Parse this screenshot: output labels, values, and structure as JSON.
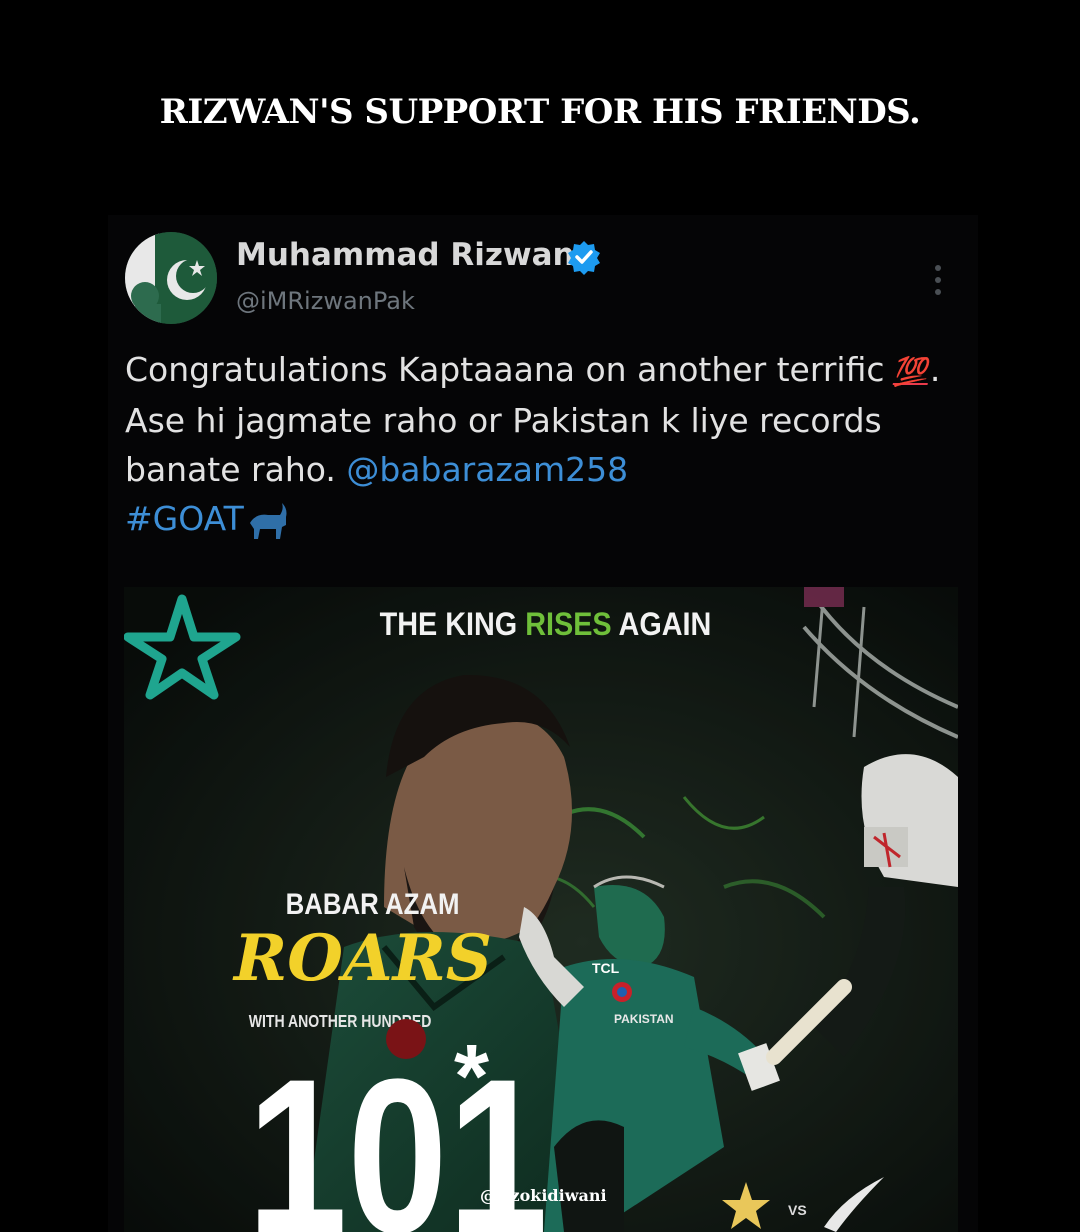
{
  "headline": "RIZWAN'S SUPPORT FOR HIS FRIENDS.",
  "tweet": {
    "author_name": "Muhammad Rizwan",
    "handle": "@iMRizwanPak",
    "verified": true,
    "text_part1": "Congratulations Kaptaaana on another terrific",
    "emoji_hundred": "💯",
    "text_part2": ". Ase hi jagmate raho or Pakistan k liye records banate raho.",
    "mention": "@babarazam258",
    "hashtag": "#GOAT",
    "icons": [
      "verified-badge-icon",
      "more-options-icon",
      "goat-icon"
    ]
  },
  "poster": {
    "heading_part1": "THE KING ",
    "heading_highlight": "RISES",
    "heading_part2": " AGAIN",
    "player_name": "BABAR AZAM",
    "verb": "ROARS",
    "subline": "WITH ANOTHER HUNDRED",
    "score": "101",
    "not_out_marker": "*",
    "vs_label": "VS",
    "jersey_sponsor": "TCL",
    "jersey_country": "PAKISTAN",
    "colors": {
      "highlight_green": "#6fbf3a",
      "roars_yellow": "#f2d12a",
      "logo_teal": "#1fa58f"
    }
  },
  "watermark": "@rizokidiwani",
  "colors": {
    "background": "#000000",
    "link_blue": "#3d8ed6",
    "verified_blue": "#1d9bf0",
    "handle_grey": "#6e767d"
  }
}
